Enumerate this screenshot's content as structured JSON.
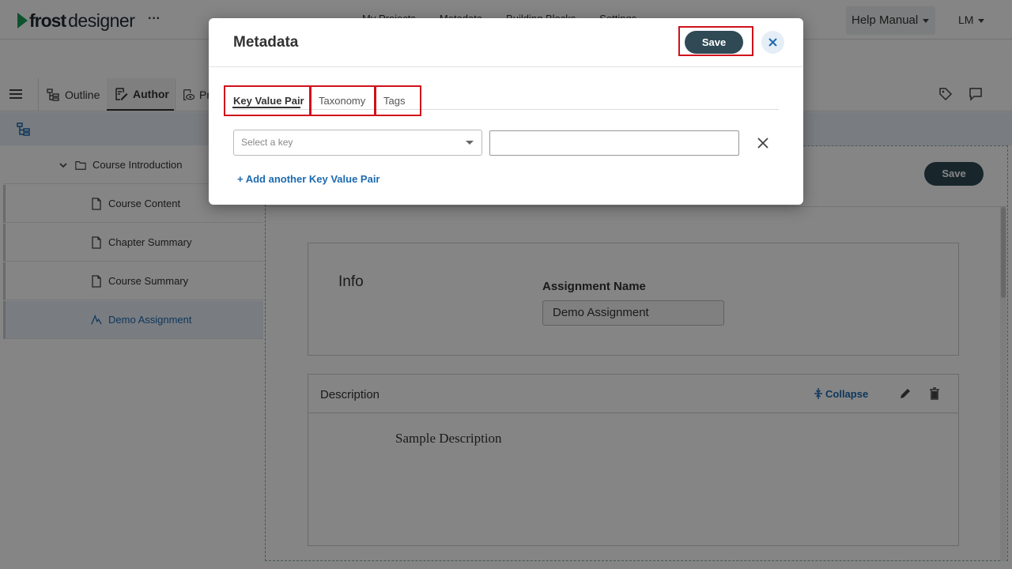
{
  "app": {
    "logo_text_bold": "frost",
    "logo_text_light": "designer",
    "more_label": "···",
    "nav": [
      "My Projects",
      "Metadata",
      "Building Blocks",
      "Settings"
    ],
    "help_label": "Help Manual",
    "user_initials": "LM"
  },
  "toolbar": {
    "tabs": [
      {
        "label": "Outline",
        "icon": "outline-icon"
      },
      {
        "label": "Author",
        "icon": "author-icon"
      },
      {
        "label": "Pr",
        "icon": "preview-icon"
      }
    ],
    "right_icons": [
      "tag-icon",
      "comment-icon"
    ]
  },
  "sidebar": {
    "items": [
      {
        "label": "Course Introduction",
        "icon": "folder-icon"
      },
      {
        "label": "Course Content",
        "icon": "file-icon"
      },
      {
        "label": "Chapter Summary",
        "icon": "file-icon"
      },
      {
        "label": "Course Summary",
        "icon": "file-icon"
      },
      {
        "label": "Demo Assignment",
        "icon": "assignment-icon"
      }
    ]
  },
  "main": {
    "save_label": "Save",
    "info_title": "Info",
    "assignment_label": "Assignment Name",
    "assignment_value": "Demo Assignment",
    "description_title": "Description",
    "collapse_label": "Collapse",
    "description_body": "Sample Description"
  },
  "modal": {
    "title": "Metadata",
    "save_label": "Save",
    "tabs": [
      "Key Value Pair",
      "Taxonomy",
      "Tags"
    ],
    "active_tab": "Key Value Pair",
    "key_placeholder": "Select a key",
    "value": "",
    "add_pair_label": "+ Add another Key Value Pair"
  },
  "colors": {
    "accent_dark": "#2f4a55",
    "link_blue": "#1c6ab0",
    "highlight_red": "#d0111b",
    "brand_green": "#1a9e5b"
  }
}
